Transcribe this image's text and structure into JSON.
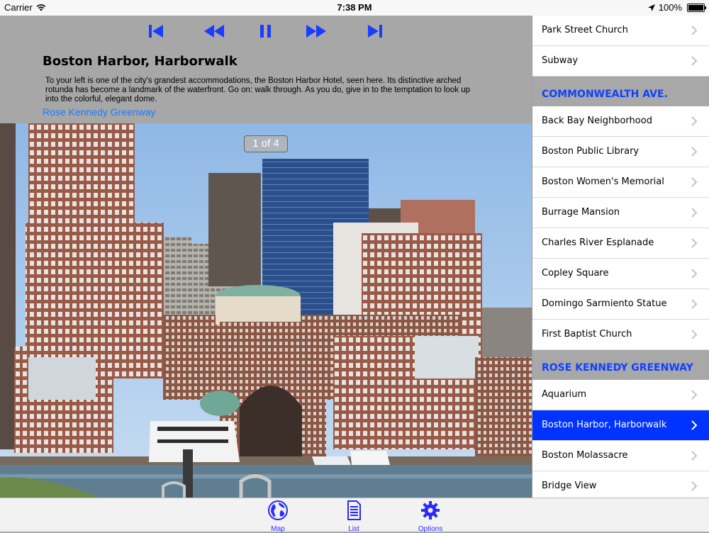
{
  "status": {
    "carrier": "Carrier",
    "time": "7:38 PM",
    "battery": "100%"
  },
  "detail": {
    "title": "Boston Harbor, Harborwalk",
    "description": "To your left is one of the city's grandest accommodations, the Boston Harbor Hotel, seen here. Its distinctive arched rotunda has become a landmark of the waterfront. Go on: walk through. As you do, give in to the temptation to look up into the colorful, elegant dome.",
    "link": "Rose Kennedy Greenway",
    "page_indicator": "1 of 4"
  },
  "player": {
    "color": "#1a3cff"
  },
  "list": {
    "group1": [
      "Park Street Church",
      "Subway"
    ],
    "section2": "COMMONWEALTH AVE.",
    "group2": [
      "Back Bay Neighborhood",
      "Boston Public Library",
      "Boston Women's Memorial",
      "Burrage Mansion",
      "Charles River Esplanade",
      "Copley Square",
      "Domingo Sarmiento Statue",
      "First Baptist Church"
    ],
    "section3": "ROSE KENNEDY GREENWAY",
    "group3": [
      "Aquarium",
      "Boston Harbor, Harborwalk",
      "Boston Molassacre",
      "Bridge View"
    ],
    "selected": "Boston Harbor, Harborwalk"
  },
  "tabs": {
    "map": "Map",
    "list": "List",
    "options": "Options"
  }
}
